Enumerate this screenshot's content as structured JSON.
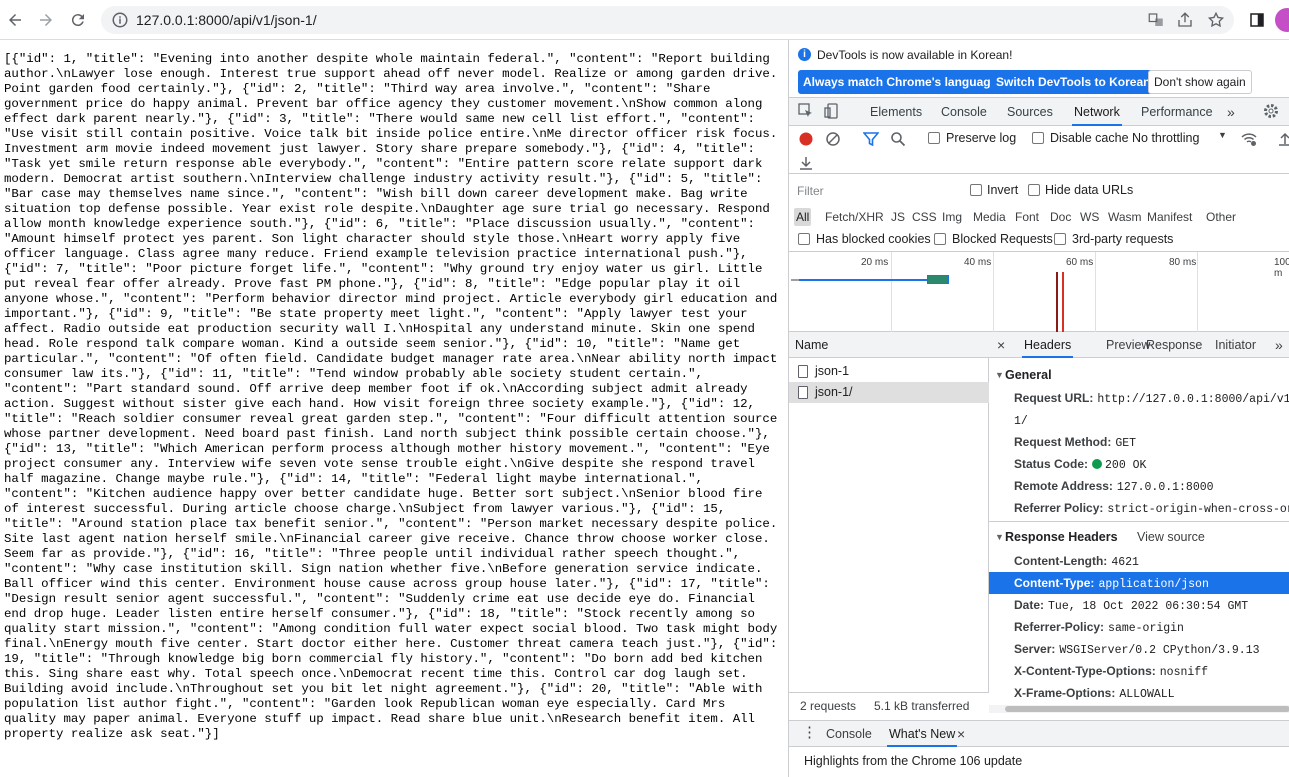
{
  "browser": {
    "url": "127.0.0.1:8000/api/v1/json-1/",
    "icons": [
      "back-arrow-icon",
      "forward-arrow-icon",
      "reload-icon",
      "info-icon",
      "translate-icon",
      "share-icon",
      "star-icon",
      "side-panel-icon"
    ]
  },
  "page": {
    "json_text": "[{\"id\": 1, \"title\": \"Evening into another despite whole maintain federal.\", \"content\": \"Report building author.\\nLawyer lose enough. Interest true support ahead off never model. Realize or among garden drive. Point garden food certainly.\"}, {\"id\": 2, \"title\": \"Third way area involve.\", \"content\": \"Share government price do happy animal. Prevent bar office agency they customer movement.\\nShow common along effect dark parent nearly.\"}, {\"id\": 3, \"title\": \"There would same new cell list effort.\", \"content\": \"Use visit still contain positive. Voice talk bit inside police entire.\\nMe director officer risk focus. Investment arm movie indeed movement just lawyer. Story share prepare somebody.\"}, {\"id\": 4, \"title\": \"Task yet smile return response able everybody.\", \"content\": \"Entire pattern score relate support dark modern. Democrat artist southern.\\nInterview challenge industry activity result.\"}, {\"id\": 5, \"title\": \"Bar case may themselves name since.\", \"content\": \"Wish bill down career development make. Bag write situation top defense possible. Year exist role despite.\\nDaughter age sure trial go necessary. Respond allow month knowledge experience south.\"}, {\"id\": 6, \"title\": \"Place discussion usually.\", \"content\": \"Amount himself protect yes parent. Son light character should style those.\\nHeart worry apply five officer language. Class agree many reduce. Friend example television practice international push.\"}, {\"id\": 7, \"title\": \"Poor picture forget life.\", \"content\": \"Why ground try enjoy water us girl. Little put reveal fear offer already. Prove fast PM phone.\"}, {\"id\": 8, \"title\": \"Edge popular play it oil anyone whose.\", \"content\": \"Perform behavior director mind project. Article everybody girl education and important.\"}, {\"id\": 9, \"title\": \"Be state property meet light.\", \"content\": \"Apply lawyer test your affect. Radio outside eat production security wall I.\\nHospital any understand minute. Skin one spend head. Role respond talk compare woman. Kind a outside seem senior.\"}, {\"id\": 10, \"title\": \"Name get particular.\", \"content\": \"Of often field. Candidate budget manager rate area.\\nNear ability north impact consumer law its.\"}, {\"id\": 11, \"title\": \"Tend window probably able society student certain.\", \"content\": \"Part standard sound. Off arrive deep member foot if ok.\\nAccording subject admit already action. Suggest without sister give each hand. How visit foreign three society example.\"}, {\"id\": 12, \"title\": \"Reach soldier consumer reveal great garden step.\", \"content\": \"Four difficult attention source whose partner development. Need board past finish. Land north subject think possible certain choose.\"}, {\"id\": 13, \"title\": \"Which American perform process although mother history movement.\", \"content\": \"Eye project consumer any. Interview wife seven vote sense trouble eight.\\nGive despite she respond travel half magazine. Change maybe rule.\"}, {\"id\": 14, \"title\": \"Federal light maybe international.\", \"content\": \"Kitchen audience happy over better candidate huge. Better sort subject.\\nSenior blood fire of interest successful. During article choose charge.\\nSubject from lawyer various.\"}, {\"id\": 15, \"title\": \"Around station place tax benefit senior.\", \"content\": \"Person market necessary despite police. Site last agent nation herself smile.\\nFinancial career give receive. Chance throw choose worker close. Seem far as provide.\"}, {\"id\": 16, \"title\": \"Three people until individual rather speech thought.\", \"content\": \"Why case institution skill. Sign nation whether five.\\nBefore generation service indicate. Ball officer wind this center. Environment house cause across group house later.\"}, {\"id\": 17, \"title\": \"Design result senior agent successful.\", \"content\": \"Suddenly crime eat use decide eye do. Financial end drop huge. Leader listen entire herself consumer.\"}, {\"id\": 18, \"title\": \"Stock recently among so quality start mission.\", \"content\": \"Among condition full water expect social blood. Two task might body final.\\nEnergy mouth five center. Start doctor either here. Customer threat camera teach just.\"}, {\"id\": 19, \"title\": \"Through knowledge big born commercial fly history.\", \"content\": \"Do born add bed kitchen this. Sing share east why. Total speech once.\\nDemocrat recent time this. Control car dog laugh set. Building avoid include.\\nThroughout set you bit let night agreement.\"}, {\"id\": 20, \"title\": \"Able with population list author fight.\", \"content\": \"Garden look Republican woman eye especially. Card Mrs quality may paper animal. Everyone stuff up impact. Read share blue unit.\\nResearch benefit item. All property realize ask seat.\"}]"
  },
  "devtools": {
    "notice": {
      "message": "DevTools is now available in Korean!",
      "btn_match": "Always match Chrome's language",
      "btn_switch": "Switch DevTools to Korean",
      "btn_dont": "Don't show again"
    },
    "tabs": [
      "Elements",
      "Console",
      "Sources",
      "Network",
      "Performance"
    ],
    "active_tab": "Network",
    "network": {
      "preserve_log": "Preserve log",
      "disable_cache": "Disable cache",
      "throttling": "No throttling",
      "filter_placeholder": "Filter",
      "invert": "Invert",
      "hide_data_urls": "Hide data URLs",
      "types": [
        "All",
        "Fetch/XHR",
        "JS",
        "CSS",
        "Img",
        "Media",
        "Font",
        "Doc",
        "WS",
        "Wasm",
        "Manifest",
        "Other"
      ],
      "has_blocked_cookies": "Has blocked cookies",
      "blocked_requests": "Blocked Requests",
      "third_party": "3rd-party requests",
      "timeline_labels": [
        "20 ms",
        "40 ms",
        "60 ms",
        "80 ms",
        "100 m"
      ],
      "name_header": "Name",
      "requests": [
        "json-1",
        "json-1/"
      ],
      "status_requests": "2 requests",
      "status_transferred": "5.1 kB transferred"
    },
    "details": {
      "tabs": [
        "Headers",
        "Preview",
        "Response",
        "Initiator"
      ],
      "general_title": "General",
      "general": [
        {
          "k": "Request URL:",
          "v": "http://127.0.0.1:8000/api/v1/json-"
        },
        {
          "k": "",
          "v": "1/"
        },
        {
          "k": "Request Method:",
          "v": "GET"
        },
        {
          "k": "Status Code:",
          "v": "200 OK"
        },
        {
          "k": "Remote Address:",
          "v": "127.0.0.1:8000"
        },
        {
          "k": "Referrer Policy:",
          "v": "strict-origin-when-cross-origin"
        }
      ],
      "response_title": "Response Headers",
      "view_source": "View source",
      "response": [
        {
          "k": "Content-Length:",
          "v": "4621"
        },
        {
          "k": "Content-Type:",
          "v": "application/json"
        },
        {
          "k": "Date:",
          "v": "Tue, 18 Oct 2022 06:30:54 GMT"
        },
        {
          "k": "Referrer-Policy:",
          "v": "same-origin"
        },
        {
          "k": "Server:",
          "v": "WSGIServer/0.2 CPython/3.9.13"
        },
        {
          "k": "X-Content-Type-Options:",
          "v": "nosniff"
        },
        {
          "k": "X-Frame-Options:",
          "v": "ALLOWALL"
        }
      ]
    },
    "drawer": {
      "tabs": [
        "Console",
        "What's New"
      ],
      "highlights": "Highlights from the Chrome 106 update"
    },
    "colors": {
      "accent": "#1a73e8",
      "record": "#d93025",
      "status_ok": "#0e9b4e"
    }
  }
}
